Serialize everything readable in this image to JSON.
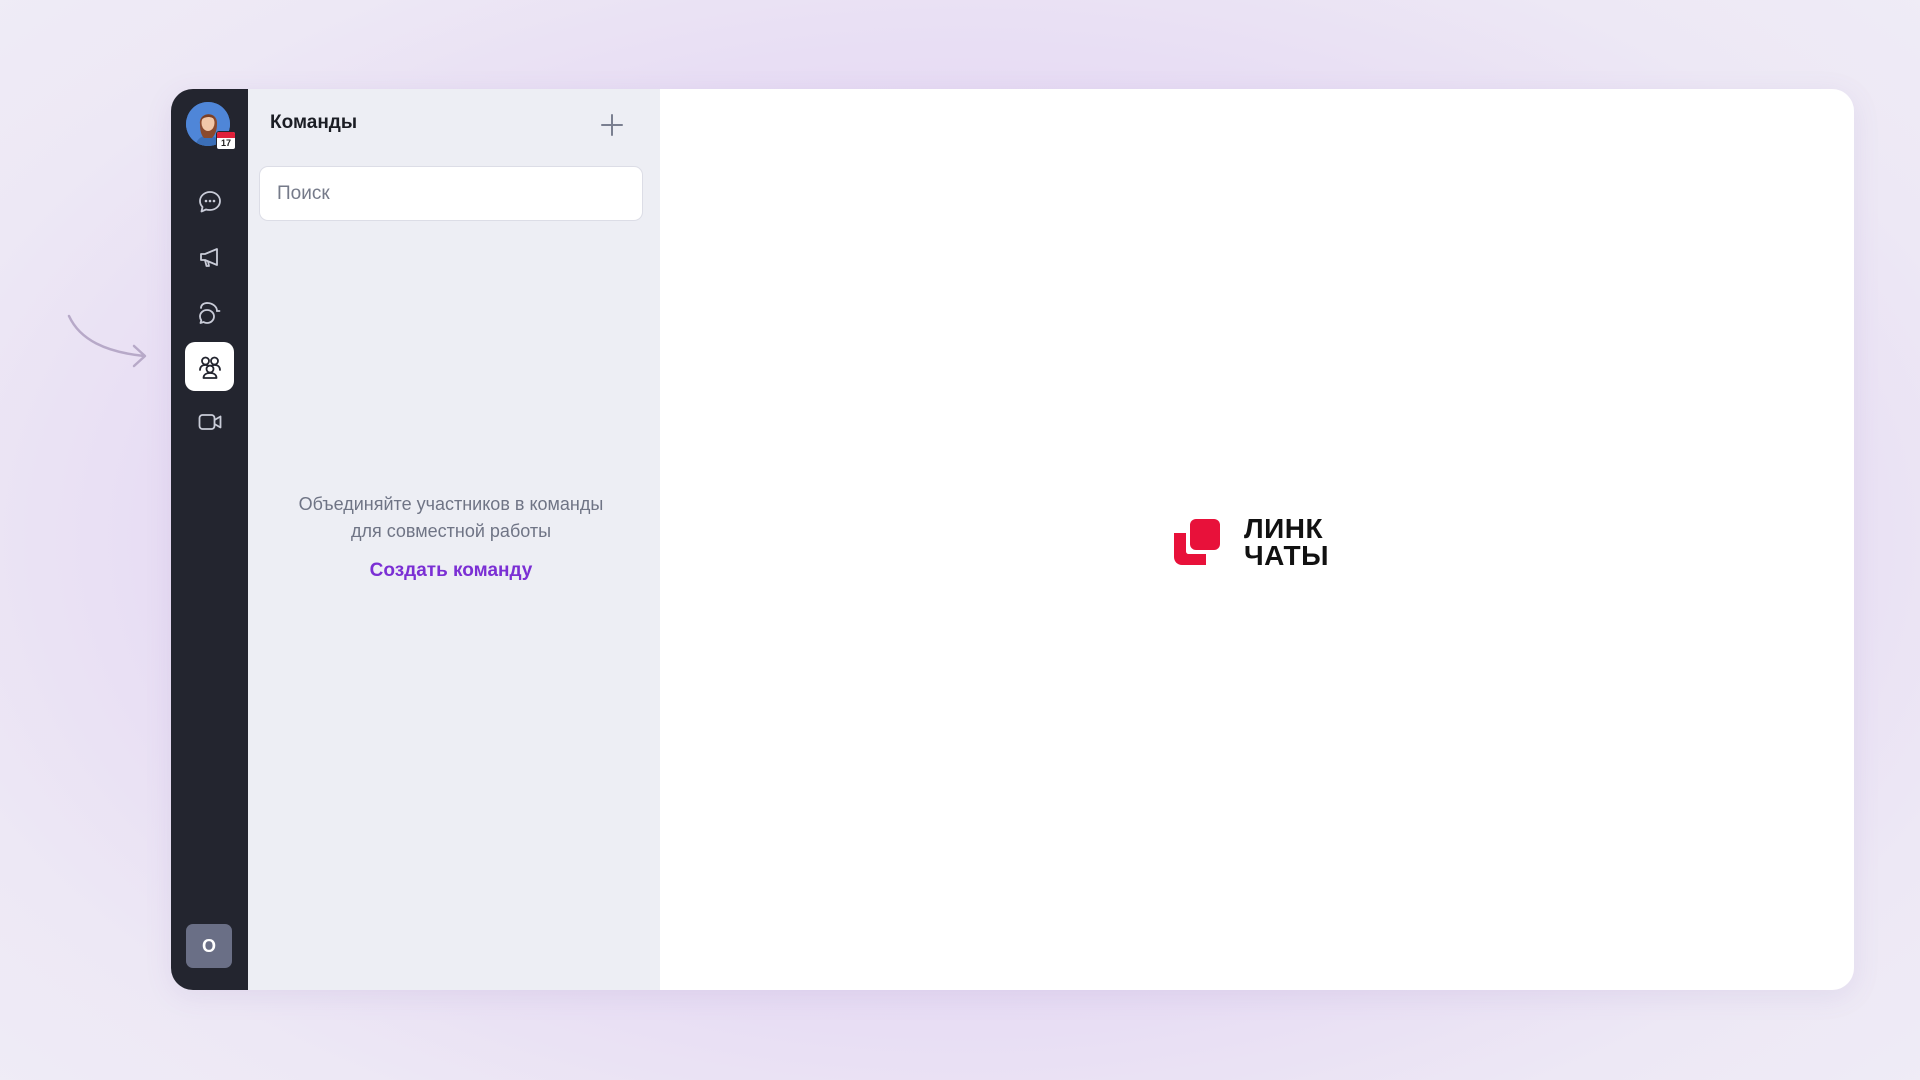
{
  "sidebar": {
    "avatar_badge_day": "17",
    "nav_items": [
      {
        "name": "chats",
        "icon": "chat-bubble-icon"
      },
      {
        "name": "channels",
        "icon": "megaphone-icon"
      },
      {
        "name": "threads",
        "icon": "threads-icon"
      },
      {
        "name": "teams",
        "icon": "people-group-icon",
        "active": true
      },
      {
        "name": "video-calls",
        "icon": "video-camera-icon"
      }
    ],
    "user_initial": "О"
  },
  "panel": {
    "title": "Команды",
    "add_icon": "plus-icon",
    "search_placeholder": "Поиск",
    "empty_text_line1": "Объединяйте участников в команды",
    "empty_text_line2": "для совместной работы",
    "create_link": "Создать команду"
  },
  "main": {
    "logo_line1": "ЛИНК",
    "logo_line2": "ЧАТЫ"
  },
  "colors": {
    "rail_bg": "#23252f",
    "panel_bg": "#edeef4",
    "accent_link": "#7b2fd4",
    "logo_red": "#e8113a"
  }
}
